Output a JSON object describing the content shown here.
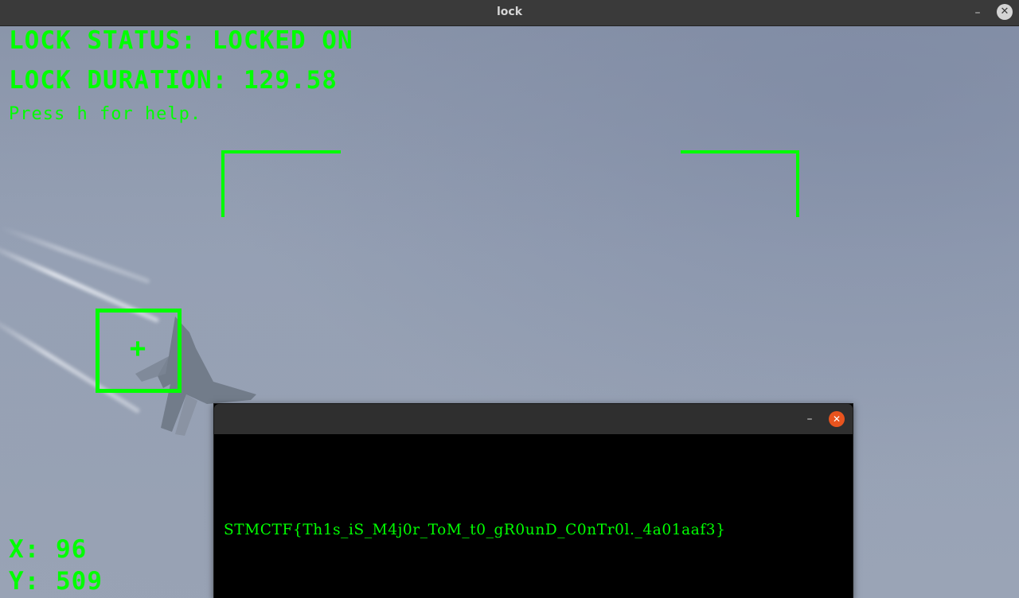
{
  "window": {
    "title": "lock",
    "minimize_glyph": "–",
    "close_glyph": "✕"
  },
  "hud": {
    "lock_status": "LOCK STATUS: LOCKED ON",
    "lock_duration": "LOCK DURATION: 129.58",
    "help_hint": "Press h for help.",
    "x_readout": "X: 96",
    "y_readout": "Y: 509",
    "crosshair_glyph": "+"
  },
  "colors": {
    "hud_green": "#00ff00",
    "popup_close": "#e9541e"
  },
  "popup": {
    "minimize_glyph": "–",
    "close_glyph": "✕",
    "flag_text": "STMCTF{Th1s_iS_M4j0r_ToM_t0_gR0unD_C0nTr0l._4a01aaf3}"
  }
}
